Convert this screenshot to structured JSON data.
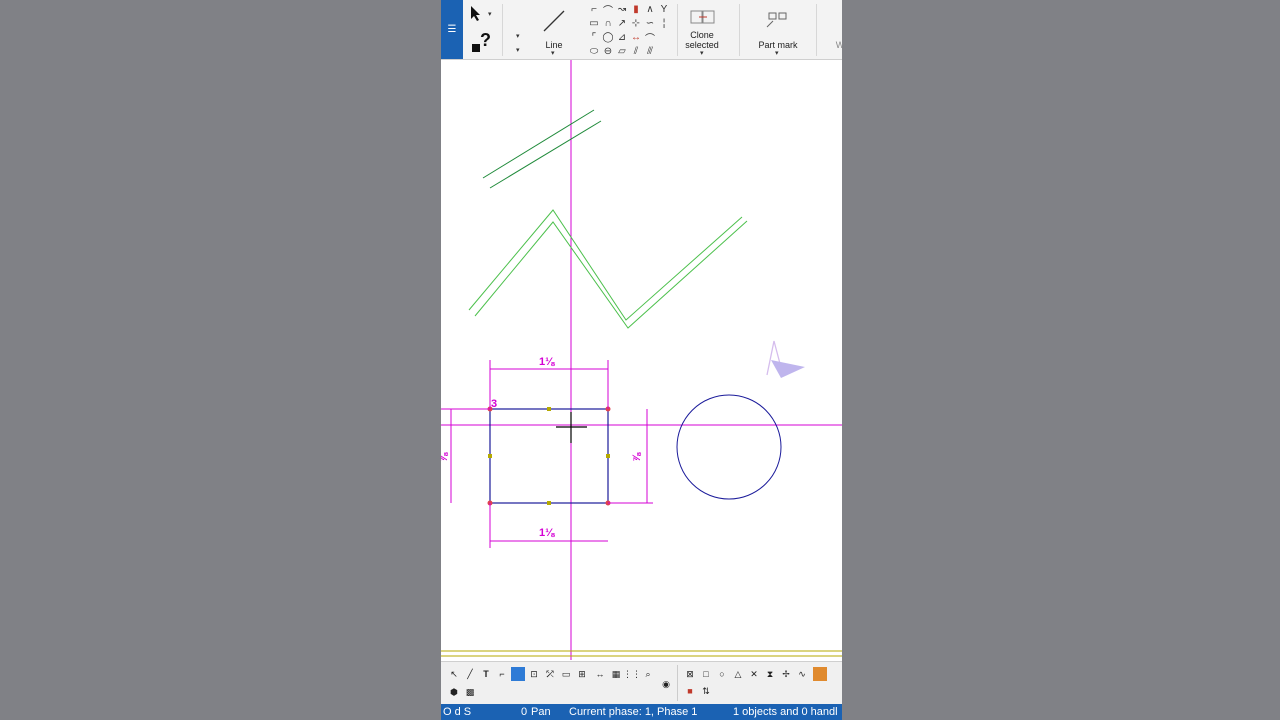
{
  "ribbon": {
    "menu_icon": "☰",
    "line_label": "Line",
    "clone_label": "Clone\nselected",
    "partmark_label": "Part mark",
    "help_glyph": "?",
    "extra_glyph": "W"
  },
  "canvas": {
    "dim_top": "1⅛",
    "dim_bottom": "1⅛",
    "dim_right": "⅞",
    "dim_left": "⅞",
    "corner_label": "3"
  },
  "colors": {
    "accent": "#1b62b3",
    "dimension": "#d400d4",
    "dark_green": "#1f8a3a",
    "light_green": "#4cc04c",
    "shape_blue": "#1a1a9a"
  },
  "statusbar": {
    "flags": "O d S",
    "count": "0",
    "mode": "Pan",
    "phase": "Current phase: 1, Phase 1",
    "selection": "1 objects and 0 handl"
  }
}
